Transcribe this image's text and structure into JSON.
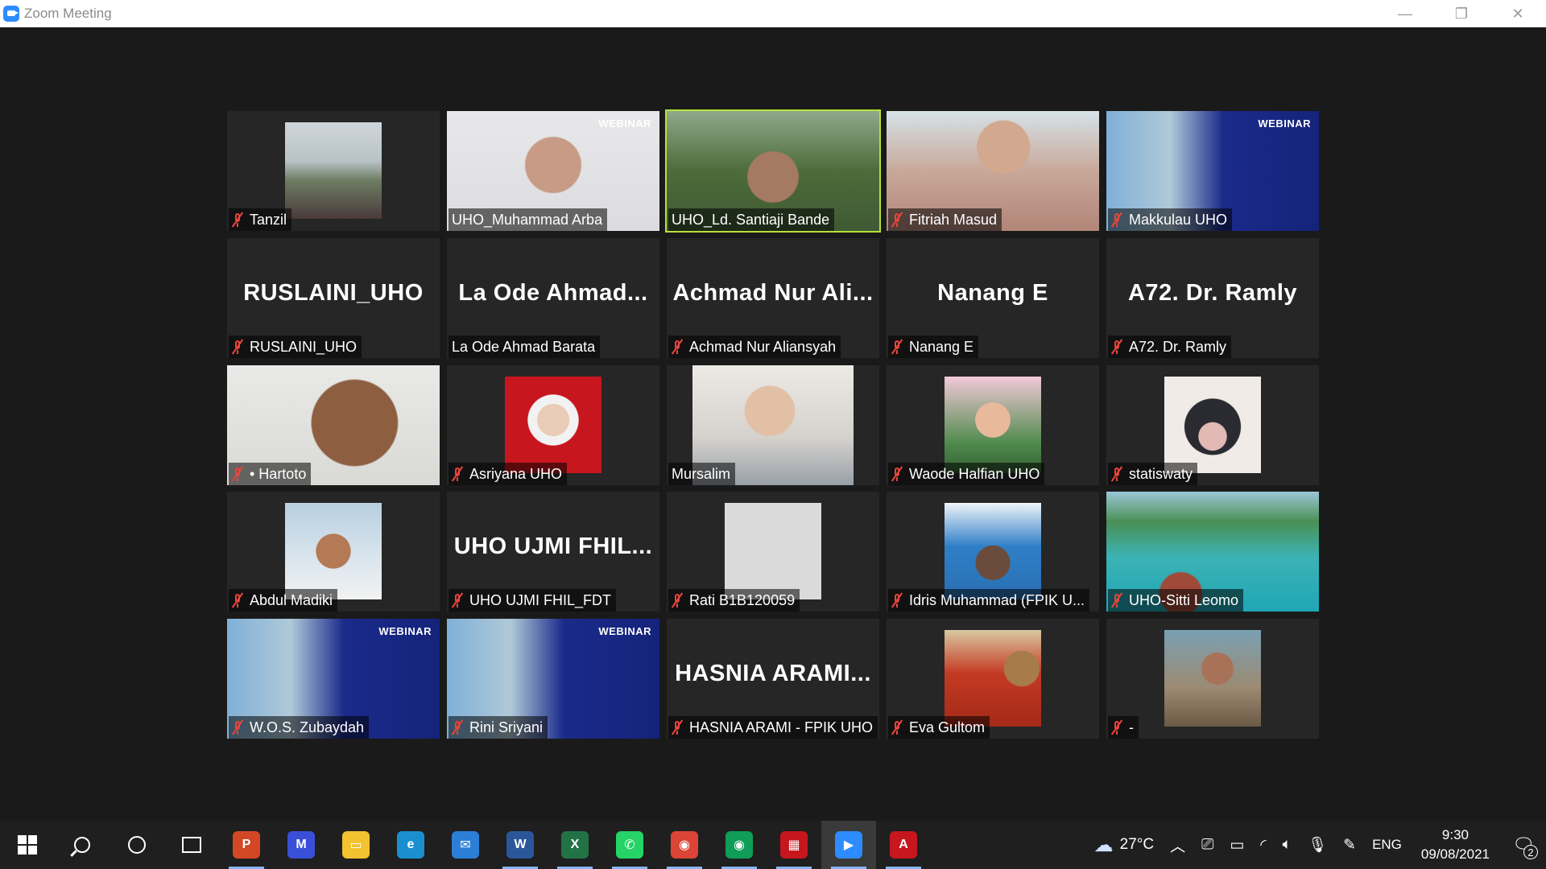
{
  "window": {
    "title": "Zoom Meeting",
    "minimize": "—",
    "maximize": "❐",
    "close": "✕"
  },
  "participants": [
    {
      "name": "Tanzil",
      "muted": true,
      "display": "video",
      "pic": "ph-photo-couple"
    },
    {
      "name": "UHO_Muhammad Arba",
      "muted": false,
      "display": "video",
      "pic": "ph-face-mask",
      "webinar": "WEBINAR"
    },
    {
      "name": "UHO_Ld. Santiaji Bande",
      "muted": false,
      "display": "video",
      "pic": "ph-aerial",
      "active": true
    },
    {
      "name": "Fitriah Masud",
      "muted": true,
      "display": "video",
      "pic": "ph-woman-pink"
    },
    {
      "name": "Makkulau UHO",
      "muted": true,
      "display": "video",
      "pic": "ph-webinar",
      "webinar": "WEBINAR"
    },
    {
      "name": "RUSLAINI_UHO",
      "muted": true,
      "display": "name",
      "big": "RUSLAINI_UHO"
    },
    {
      "name": "La Ode Ahmad Barata",
      "muted": false,
      "display": "name",
      "big": "La Ode Ahmad..."
    },
    {
      "name": "Achmad Nur Aliansyah",
      "muted": true,
      "display": "name",
      "big": "Achmad Nur Ali..."
    },
    {
      "name": "Nanang E",
      "muted": true,
      "display": "name",
      "big": "Nanang E"
    },
    {
      "name": "A72. Dr. Ramly",
      "muted": true,
      "display": "name",
      "big": "A72. Dr. Ramly"
    },
    {
      "name": "• Hartoto",
      "muted": true,
      "display": "video",
      "pic": "ph-headset"
    },
    {
      "name": "Asriyana UHO",
      "muted": true,
      "display": "video",
      "pic": "ph-red"
    },
    {
      "name": "Mursalim",
      "muted": false,
      "display": "video",
      "pic": "ph-man-glasses"
    },
    {
      "name": "Waode Halfian UHO",
      "muted": true,
      "display": "video",
      "pic": "ph-baby"
    },
    {
      "name": "statiswaty",
      "muted": true,
      "display": "video",
      "pic": "ph-mask-hijab"
    },
    {
      "name": "Abdul Madiki",
      "muted": true,
      "display": "video",
      "pic": "ph-man-sea"
    },
    {
      "name": "UHO UJMI FHIL_FDT",
      "muted": true,
      "display": "name",
      "big": "UHO UJMI FHIL..."
    },
    {
      "name": "Rati B1B120059",
      "muted": true,
      "display": "video",
      "pic": "ph-gray"
    },
    {
      "name": "Idris Muhammad (FPIK U...",
      "muted": true,
      "display": "video",
      "pic": "ph-woman-blue"
    },
    {
      "name": "UHO-Sitti Leomo",
      "muted": true,
      "display": "video",
      "pic": "ph-lagoon"
    },
    {
      "name": "W.O.S. Zubaydah",
      "muted": true,
      "display": "video",
      "pic": "ph-webinar",
      "webinar": "WEBINAR"
    },
    {
      "name": "Rini Sriyani",
      "muted": true,
      "display": "video",
      "pic": "ph-webinar",
      "webinar": "WEBINAR"
    },
    {
      "name": "HASNIA ARAMI - FPIK UHO",
      "muted": true,
      "display": "name",
      "big": "HASNIA  ARAMI..."
    },
    {
      "name": "Eva Gultom",
      "muted": true,
      "display": "video",
      "pic": "ph-phonebooth"
    },
    {
      "name": "-",
      "muted": true,
      "display": "video",
      "pic": "ph-man-boat"
    }
  ],
  "taskbar": {
    "apps": [
      {
        "name": "powerpoint-icon",
        "glyph": "P",
        "color": "#d24726"
      },
      {
        "name": "editor-icon",
        "glyph": "M",
        "color": "#3a4fd8"
      },
      {
        "name": "file-explorer-icon",
        "glyph": "▭",
        "color": "#f2c230"
      },
      {
        "name": "edge-icon",
        "glyph": "e",
        "color": "#1a8fd0"
      },
      {
        "name": "mail-icon",
        "glyph": "✉",
        "color": "#2b7fd6"
      },
      {
        "name": "word-icon",
        "glyph": "W",
        "color": "#2b579a"
      },
      {
        "name": "excel-icon",
        "glyph": "X",
        "color": "#217346"
      },
      {
        "name": "whatsapp-icon",
        "glyph": "✆",
        "color": "#25d366"
      },
      {
        "name": "chrome-icon",
        "glyph": "◉",
        "color": "#db4437"
      },
      {
        "name": "chrome-profile-icon",
        "glyph": "◉",
        "color": "#0f9d58"
      },
      {
        "name": "app-red-grid-icon",
        "glyph": "▦",
        "color": "#c8161e"
      },
      {
        "name": "zoom-icon",
        "glyph": "▶",
        "color": "#2d8cff"
      },
      {
        "name": "acrobat-icon",
        "glyph": "A",
        "color": "#c8161e"
      }
    ],
    "weather": "27°C",
    "language": "ENG",
    "time": "9:30",
    "date": "09/08/2021",
    "notifications": "2"
  }
}
